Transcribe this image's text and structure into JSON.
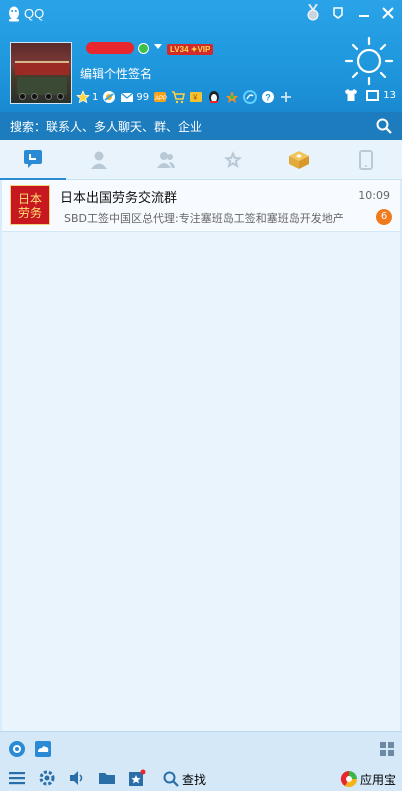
{
  "window": {
    "title": "QQ",
    "accent": "#1f97dd",
    "buttons": {
      "medal": "medal-icon",
      "skin": "skin-icon",
      "minimize": "minimize-icon",
      "close": "close-icon"
    }
  },
  "profile": {
    "level_badge": "LV34 ✦VIP",
    "signature": "编辑个性签名",
    "apps": [
      {
        "icon": "star-icon",
        "count": "1"
      },
      {
        "icon": "qzone-icon",
        "count": ""
      },
      {
        "icon": "mail-icon",
        "count": "99"
      },
      {
        "icon": "app-icon",
        "count": ""
      },
      {
        "icon": "cart-icon",
        "count": ""
      },
      {
        "icon": "wallet-icon",
        "count": ""
      },
      {
        "icon": "penguin-icon",
        "count": ""
      },
      {
        "icon": "game-icon",
        "count": ""
      },
      {
        "icon": "qq-browser-icon",
        "count": ""
      },
      {
        "icon": "help-icon",
        "count": ""
      },
      {
        "icon": "add-icon",
        "count": ""
      }
    ],
    "message_box_count": "13",
    "weather_icon": "sun-icon"
  },
  "search": {
    "placeholder": "搜索：联系人、多人聊天、群、企业"
  },
  "tabs": [
    {
      "name": "conversations",
      "icon": "chat-bubble-icon",
      "active": true
    },
    {
      "name": "contacts",
      "icon": "person-icon",
      "active": false
    },
    {
      "name": "groups",
      "icon": "group-icon",
      "active": false
    },
    {
      "name": "favorites",
      "icon": "star-icon",
      "active": false
    },
    {
      "name": "apps",
      "icon": "box-icon",
      "active": false
    },
    {
      "name": "phone",
      "icon": "phone-icon",
      "active": false
    }
  ],
  "conversations": [
    {
      "avatar_text": "日本劳务",
      "title": "日本出国劳务交流群",
      "time": "10:09",
      "preview": "SBD工签中国区总代理:专注塞班岛工签和塞班岛开发地产",
      "unread": "6"
    }
  ],
  "bottom": {
    "find_label": "查找",
    "store_label": "应用宝"
  }
}
